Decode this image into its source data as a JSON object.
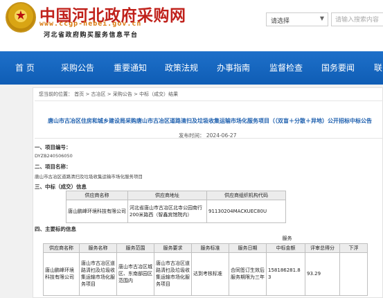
{
  "header": {
    "site_title": "中国河北政府采购网",
    "site_url": "www.ccgp-hebei.gov.cn",
    "site_subtitle": "河北省政府购买服务信息平台",
    "logo_icon": "national-emblem-icon",
    "search": {
      "select_value": "请选择",
      "placeholder": "请输入搜索内容"
    }
  },
  "nav": {
    "items": [
      "首 页",
      "采购公告",
      "重要通知",
      "政策法规",
      "办事指南",
      "监督检查",
      "国务要闻",
      "联"
    ]
  },
  "breadcrumb": "您当前的位置： 首页 > 古冶区 > 采购公告 > 中标（成交）结果",
  "article": {
    "title": "唐山市古冶区住房和城乡建设局采购唐山市古冶区道路清扫及垃圾收集运输市场化服务项目（（双盲＋分散＋异地）公开招标中标公告",
    "publish_time": "发布时间： 2024-06-27",
    "section1_heading": "一、项目编号：",
    "project_code": "DYZB240506050",
    "section2_heading": "二、项目名称：",
    "project_name": "唐山市古冶区道路清扫及垃圾收集运输市场化服务项目",
    "section3_heading": "三、中标（成交）信息",
    "section4_heading": "四、主要标的信息"
  },
  "winner_table": {
    "headers": [
      "供应商名称",
      "供应商地址",
      "供应商组织机构代码"
    ],
    "rows": [
      [
        "唐山鹏峰环境科技有限公司",
        "河北省唐山市古冶区北寺公园南行200米路西（智鑫宾馆院内）",
        "91130204MACKUEC80U"
      ]
    ]
  },
  "subject_table": {
    "group_header": "服务",
    "headers": [
      "供应商名称",
      "服务名称",
      "服务范围",
      "服务要求",
      "服务标准",
      "服务日期",
      "中标金额",
      "评审总得分",
      "下浮"
    ],
    "rows": [
      [
        "唐山鹏峰环境科技有限公司",
        "唐山市古冶区道路清扫及垃圾收集运输市场化服务项目",
        "唐山市古冶区城区、东南部园区范围内",
        "唐山市古冶区道路清扫及垃圾收集运输市场化服务项目",
        "达到考核标准",
        "合同签订生效后服务期限为三年",
        "158186281.83",
        "93.29",
        ""
      ]
    ]
  }
}
